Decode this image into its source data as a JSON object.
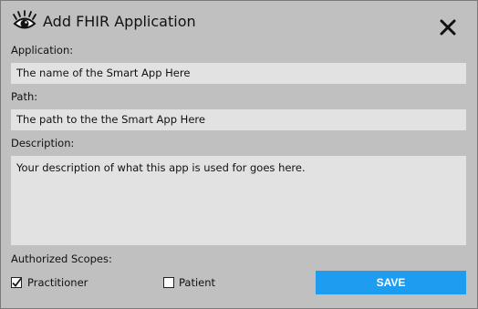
{
  "dialog": {
    "title": "Add FHIR Application",
    "title_icon": "eye-icon",
    "close_icon": "close-icon"
  },
  "form": {
    "application_label": "Application:",
    "application_value": "The name of the Smart App Here",
    "path_label": "Path:",
    "path_value": "The path to the the Smart App Here",
    "description_label": "Description:",
    "description_value": "Your description of what this app is used for goes here.",
    "scopes_label": "Authorized Scopes:",
    "scopes": [
      {
        "label": "Practitioner",
        "checked": true
      },
      {
        "label": "Patient",
        "checked": false
      }
    ]
  },
  "actions": {
    "save_label": "SAVE",
    "save_color": "#1e9cf0"
  }
}
